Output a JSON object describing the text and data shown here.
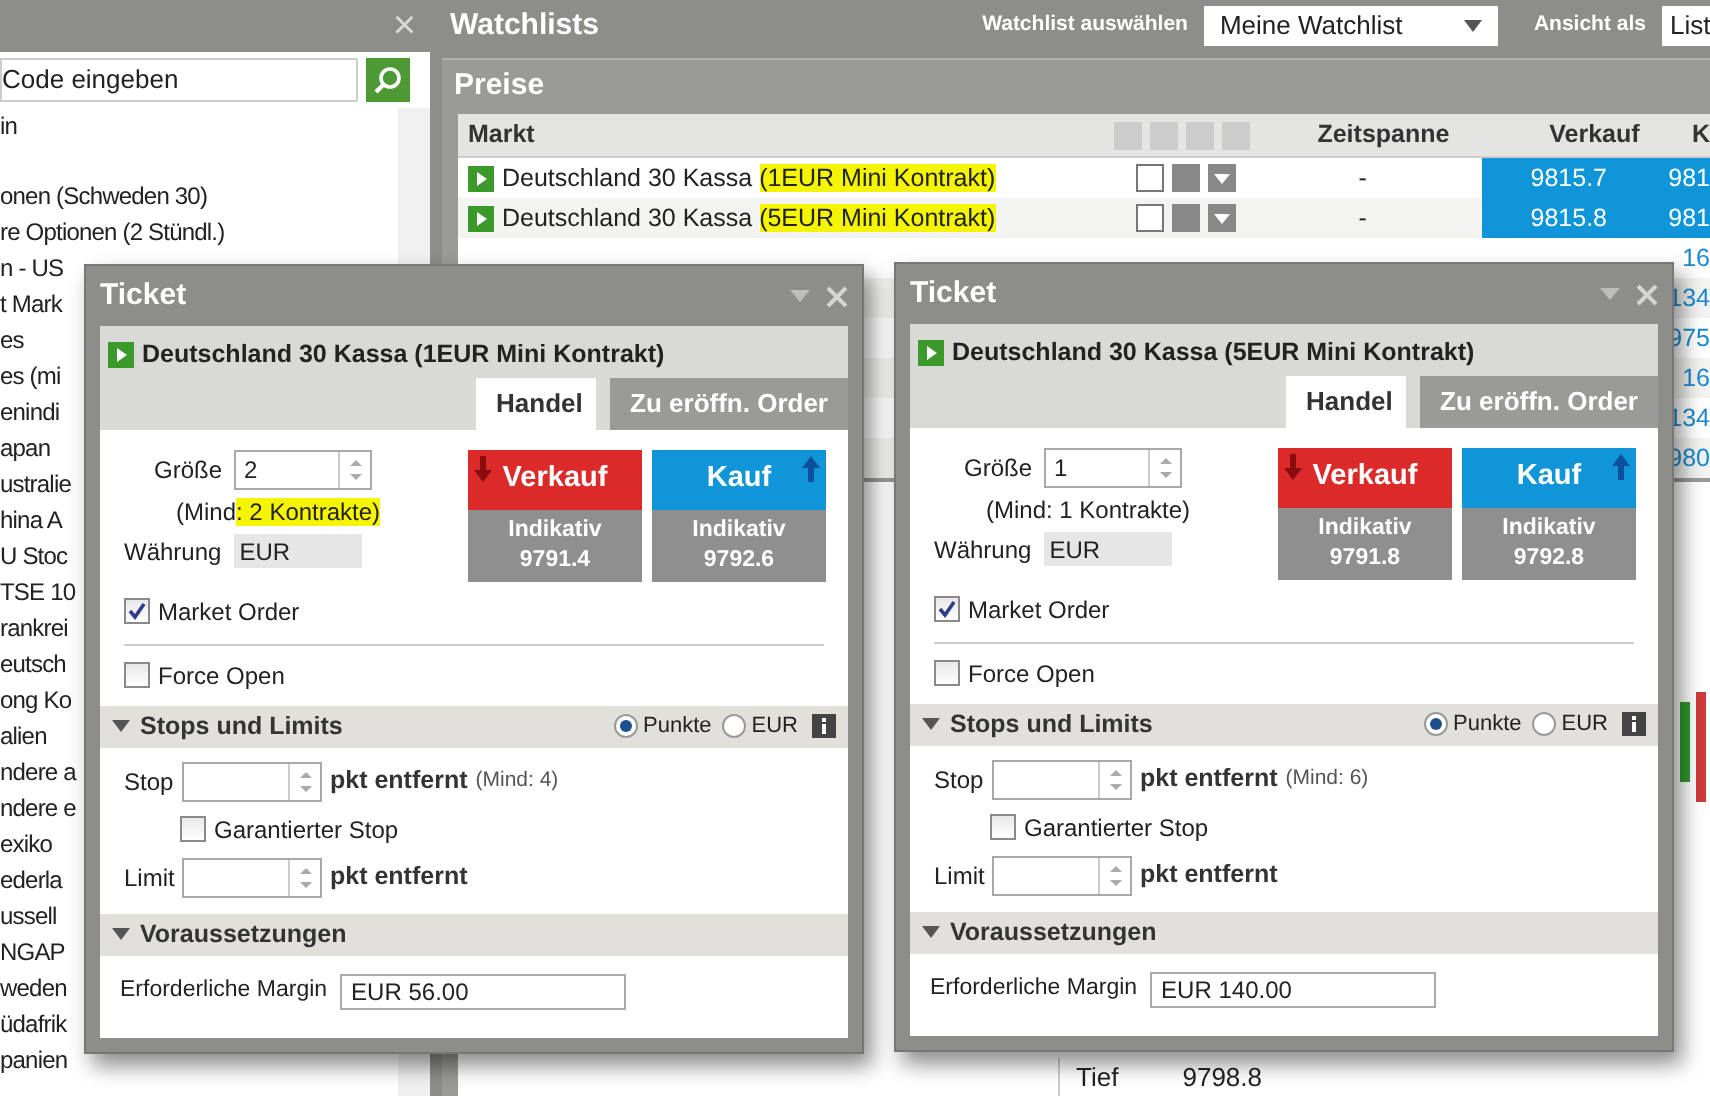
{
  "sidebar": {
    "close": "×",
    "search": {
      "value": "Code eingeben"
    },
    "items": [
      {
        "text": "in"
      },
      {
        "text": "onen (Schweden 30)"
      },
      {
        "text": "re Optionen (2 Stündl.)"
      },
      {
        "text": "n - US"
      },
      {
        "text": "t Mark"
      },
      {
        "text": "es"
      },
      {
        "text": "es (mi"
      },
      {
        "text": "enindi"
      },
      {
        "text": "apan"
      },
      {
        "text": "ustralie"
      },
      {
        "text": "hina A"
      },
      {
        "text": "U Stoc"
      },
      {
        "text": "TSE 10"
      },
      {
        "text": "rankrei"
      },
      {
        "text": "eutsch"
      },
      {
        "text": "ong Ko"
      },
      {
        "text": "alien"
      },
      {
        "text": "ndere a"
      },
      {
        "text": "ndere e"
      },
      {
        "text": "exiko"
      },
      {
        "text": "ederla"
      },
      {
        "text": "ussell"
      },
      {
        "text": "NGAP"
      },
      {
        "text": "weden"
      },
      {
        "text": "üdafrik"
      },
      {
        "text": "panien"
      }
    ]
  },
  "watchlist": {
    "title": "Watchlists",
    "select_label": "Watchlist auswählen",
    "select_value": "Meine Watchlist",
    "view_label": "Ansicht als",
    "view_value": "List"
  },
  "prices": {
    "title": "Preise",
    "columns": [
      "Markt",
      "Zeitspanne",
      "Verkauf",
      "K"
    ],
    "rows": [
      {
        "market": [
          {
            "text": "Deutschland 30 Kassa ",
            "marked": false
          },
          {
            "text": "(1EUR Mini Kontrakt)",
            "marked": true
          }
        ],
        "timespan": "-",
        "sell": "9815.7",
        "buy": "981",
        "flash": true
      },
      {
        "market": [
          {
            "text": "Deutschland 30 Kassa ",
            "marked": false
          },
          {
            "text": "(5EUR Mini Kontrakt)",
            "marked": true
          }
        ],
        "timespan": "-",
        "sell": "9815.8",
        "buy": "981",
        "flash": true
      },
      {
        "buy": "16",
        "flash": false
      },
      {
        "buy": "134",
        "flash": false
      },
      {
        "buy": "975",
        "flash": false
      },
      {
        "buy": "16",
        "flash": false
      },
      {
        "buy": "134",
        "flash": false
      },
      {
        "buy": "980",
        "flash": false
      }
    ]
  },
  "stats": {
    "label": "Tief",
    "value": "9798.8"
  },
  "tickets": [
    {
      "title": "Ticket",
      "market": "Deutschland 30 Kassa (1EUR Mini Kontrakt)",
      "tabs": [
        {
          "label": "Handel",
          "selected": true
        },
        {
          "label": "Zu eröffn. Order",
          "selected": false
        }
      ],
      "size_label": "Größe",
      "size": "2",
      "min_note": [
        {
          "text": "(Mind",
          "marked": false
        },
        {
          "text": ": 2 Kontrakte)",
          "marked": true
        }
      ],
      "currency_label": "Währung",
      "currency": "EUR",
      "sell": {
        "label": "Verkauf",
        "sub": "Indikativ",
        "price": "9791.4"
      },
      "buy": {
        "label": "Kauf",
        "sub": "Indikativ",
        "price": "9792.6"
      },
      "checks": [
        {
          "label": "Market Order",
          "checked": true
        },
        {
          "label": "Force Open",
          "checked": false
        }
      ],
      "stops": {
        "title": "Stops und Limits",
        "units": [
          {
            "label": "Punkte",
            "selected": true
          },
          {
            "label": "EUR",
            "selected": false
          }
        ],
        "stop_label": "Stop",
        "unit_text": "pkt entfernt",
        "stop_min": "(Mind: 4)",
        "guaranteed": {
          "label": "Garantierter Stop",
          "checked": false
        },
        "limit_label": "Limit",
        "limit_unit": "pkt entfernt"
      },
      "requirements": {
        "title": "Voraussetzungen",
        "margin_label": "Erforderliche Margin",
        "margin": "EUR 56.00"
      }
    },
    {
      "title": "Ticket",
      "market": "Deutschland 30 Kassa (5EUR Mini Kontrakt)",
      "tabs": [
        {
          "label": "Handel",
          "selected": true
        },
        {
          "label": "Zu eröffn. Order",
          "selected": false
        }
      ],
      "size_label": "Größe",
      "size": "1",
      "min_note": [
        {
          "text": "(Mind: 1 Kontrakte)",
          "marked": false
        }
      ],
      "currency_label": "Währung",
      "currency": "EUR",
      "sell": {
        "label": "Verkauf",
        "sub": "Indikativ",
        "price": "9791.8"
      },
      "buy": {
        "label": "Kauf",
        "sub": "Indikativ",
        "price": "9792.8"
      },
      "checks": [
        {
          "label": "Market Order",
          "checked": true
        },
        {
          "label": "Force Open",
          "checked": false
        }
      ],
      "stops": {
        "title": "Stops und Limits",
        "units": [
          {
            "label": "Punkte",
            "selected": true
          },
          {
            "label": "EUR",
            "selected": false
          }
        ],
        "stop_label": "Stop",
        "unit_text": "pkt entfernt",
        "stop_min": "(Mind: 6)",
        "guaranteed": {
          "label": "Garantierter Stop",
          "checked": false
        },
        "limit_label": "Limit",
        "limit_unit": "pkt entfernt"
      },
      "requirements": {
        "title": "Voraussetzungen",
        "margin_label": "Erforderliche Margin",
        "margin": "EUR 140.00"
      }
    }
  ]
}
